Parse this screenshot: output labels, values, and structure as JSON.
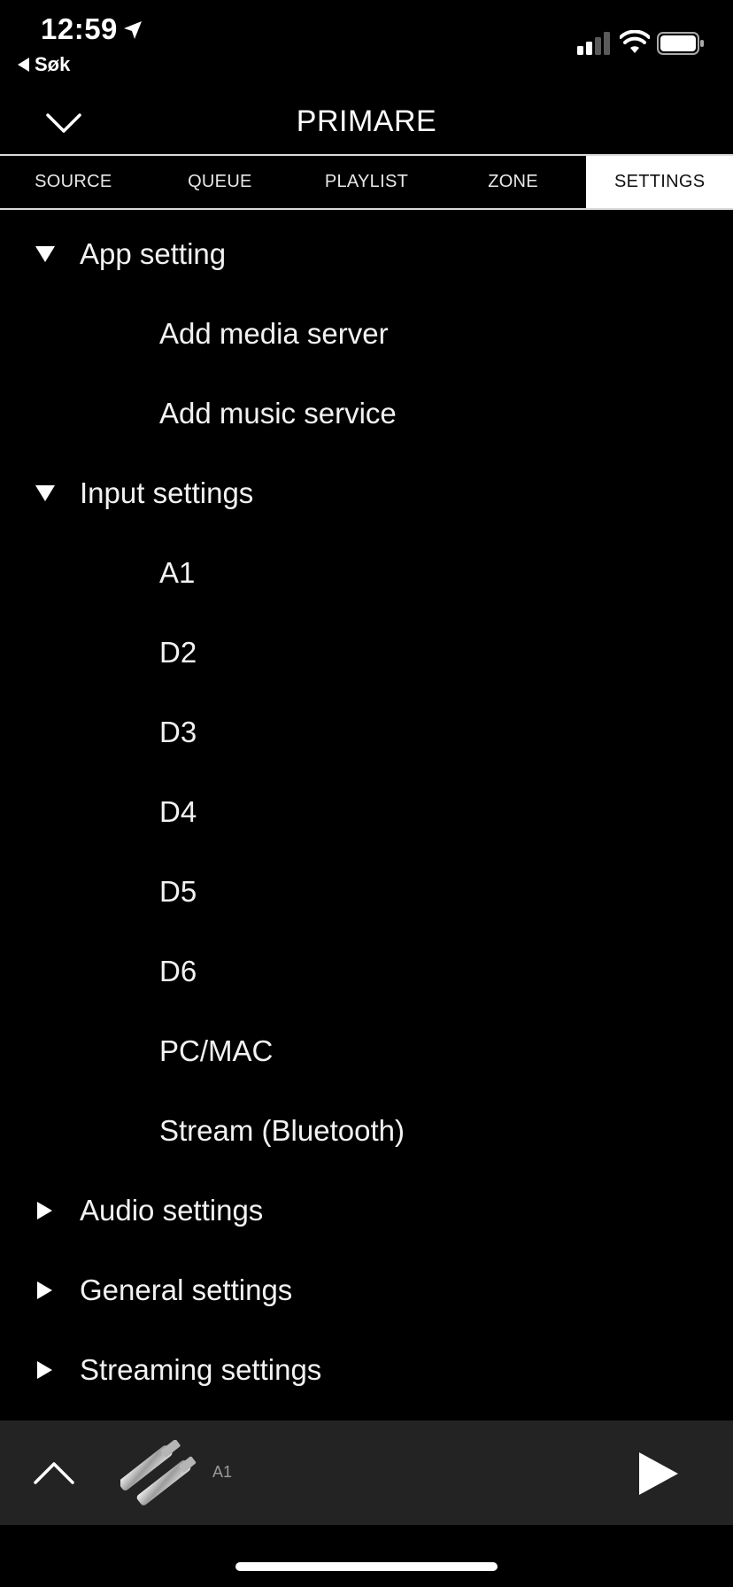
{
  "status_bar": {
    "time": "12:59",
    "back_app": "Søk"
  },
  "header": {
    "title": "PRIMARE"
  },
  "tabs": [
    {
      "label": "SOURCE",
      "active": false
    },
    {
      "label": "QUEUE",
      "active": false
    },
    {
      "label": "PLAYLIST",
      "active": false
    },
    {
      "label": "ZONE",
      "active": false
    },
    {
      "label": "SETTINGS",
      "active": true
    }
  ],
  "settings": {
    "app_setting": {
      "label": "App setting",
      "expanded": true,
      "items": [
        "Add media server",
        "Add music service"
      ]
    },
    "input_settings": {
      "label": "Input settings",
      "expanded": true,
      "items": [
        "A1",
        "D2",
        "D3",
        "D4",
        "D5",
        "D6",
        "PC/MAC",
        "Stream (Bluetooth)"
      ]
    },
    "audio_settings": {
      "label": "Audio settings",
      "expanded": false
    },
    "general_settings": {
      "label": "General settings",
      "expanded": false
    },
    "streaming_settings": {
      "label": "Streaming settings",
      "expanded": false
    }
  },
  "player": {
    "source": "A1"
  },
  "colors": {
    "background": "#000000",
    "player_bar": "#232323",
    "active_tab": "#ffffff"
  }
}
